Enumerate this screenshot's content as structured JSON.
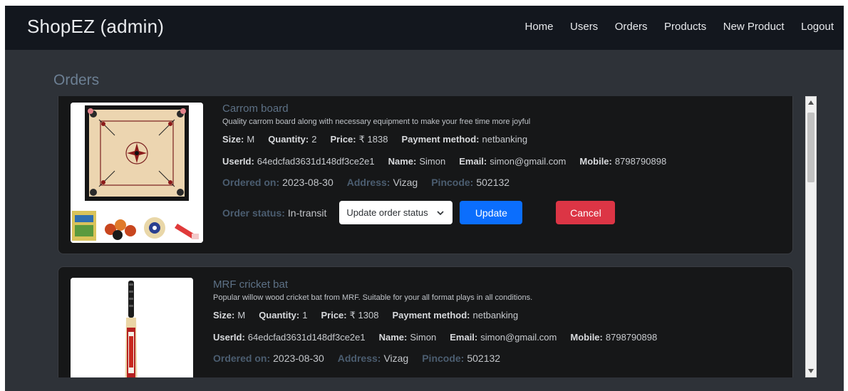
{
  "navbar": {
    "brand": "ShopEZ (admin)",
    "links": [
      "Home",
      "Users",
      "Orders",
      "Products",
      "New Product",
      "Logout"
    ]
  },
  "page": {
    "title": "Orders"
  },
  "orders": [
    {
      "title": "Carrom board",
      "description": "Quality carrom board along with necessary equipment to make your free time more joyful",
      "size_label": "Size:",
      "size": "M",
      "quantity_label": "Quantity:",
      "quantity": "2",
      "price_label": "Price:",
      "price": "₹ 1838",
      "payment_label": "Payment method:",
      "payment": "netbanking",
      "userid_label": "UserId:",
      "userid": "64edcfad3631d148df3ce2e1",
      "name_label": "Name:",
      "name": "Simon",
      "email_label": "Email:",
      "email": "simon@gmail.com",
      "mobile_label": "Mobile:",
      "mobile": "8798790898",
      "ordered_label": "Ordered on:",
      "ordered": "2023-08-30",
      "address_label": "Address:",
      "address": "Vizag",
      "pincode_label": "Pincode:",
      "pincode": "502132",
      "status_label": "Order status:",
      "status": "In-transit",
      "select_placeholder": "Update order status",
      "update_label": "Update",
      "cancel_label": "Cancel"
    },
    {
      "title": "MRF cricket bat",
      "description": "Popular willow wood cricket bat from MRF. Suitable for your all format plays in all conditions.",
      "size_label": "Size:",
      "size": "M",
      "quantity_label": "Quantity:",
      "quantity": "1",
      "price_label": "Price:",
      "price": "₹ 1308",
      "payment_label": "Payment method:",
      "payment": "netbanking",
      "userid_label": "UserId:",
      "userid": "64edcfad3631d148df3ce2e1",
      "name_label": "Name:",
      "name": "Simon",
      "email_label": "Email:",
      "email": "simon@gmail.com",
      "mobile_label": "Mobile:",
      "mobile": "8798790898",
      "ordered_label": "Ordered on:",
      "ordered": "2023-08-30",
      "address_label": "Address:",
      "address": "Vizag",
      "pincode_label": "Pincode:",
      "pincode": "502132"
    }
  ],
  "colors": {
    "navbar_bg": "#13171e",
    "page_bg": "#2e3238",
    "card_bg": "#161718",
    "primary": "#0b6efd",
    "danger": "#dc3545",
    "muted_label": "#4b5d70"
  },
  "icons": {
    "select": "chevron-down-icon",
    "scroll_up": "triangle-up-icon",
    "scroll_down": "triangle-down-icon"
  }
}
